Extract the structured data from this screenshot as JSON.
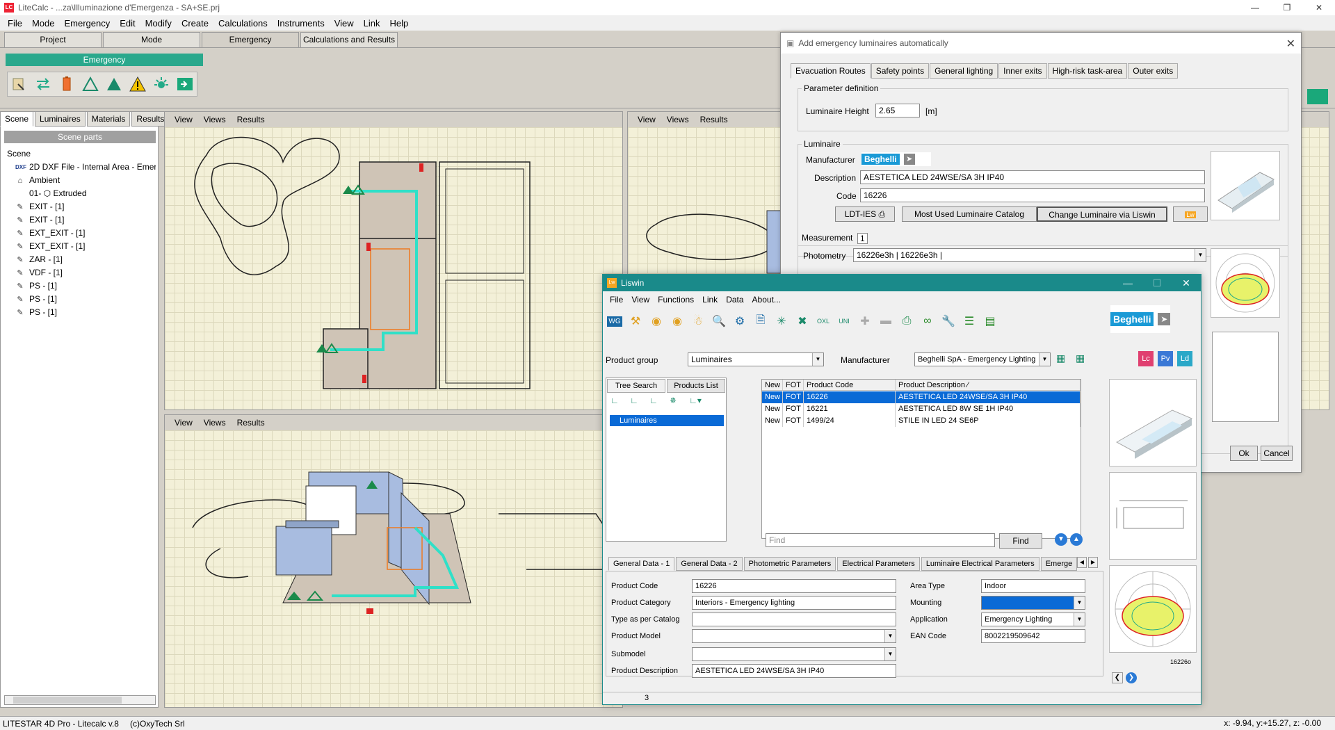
{
  "app": {
    "title": "LiteCalc - ...za\\Illuminazione d'Emergenza - SA+SE.prj",
    "icon_text": "LC",
    "window_controls": [
      "—",
      "❐",
      "✕"
    ]
  },
  "menubar": [
    "File",
    "Mode",
    "Emergency",
    "Edit",
    "Modify",
    "Create",
    "Calculations",
    "Instruments",
    "View",
    "Link",
    "Help"
  ],
  "ribbon_tabs": [
    {
      "label": "Project",
      "active": false
    },
    {
      "label": "Mode",
      "active": false
    },
    {
      "label": "Emergency",
      "active": true
    },
    {
      "label": "Calculations and Results",
      "active": false
    }
  ],
  "ribbon": {
    "group_label": "Emergency",
    "icons": [
      "place-luminaire-icon",
      "swap-icon",
      "battery-icon",
      "triangle-outline-icon",
      "triangle-filled-icon",
      "warning-icon",
      "lamp-icon",
      "exit-sign-icon"
    ]
  },
  "left_panel": {
    "tabs": [
      "Scene",
      "Luminaires",
      "Materials",
      "Results"
    ],
    "active_tab": "Scene",
    "header": "Scene parts",
    "tree": [
      {
        "label": "Scene",
        "icon": ""
      },
      {
        "label": "2D DXF File - Internal Area - Emer",
        "icon": "DXF"
      },
      {
        "label": "Ambient",
        "icon": "⌂"
      },
      {
        "label": "01- ⬡ Extruded",
        "icon": ""
      },
      {
        "label": "EXIT - [1]",
        "icon": "✎"
      },
      {
        "label": "EXIT - [1]",
        "icon": "✎"
      },
      {
        "label": "EXT_EXIT - [1]",
        "icon": "✎"
      },
      {
        "label": "EXT_EXIT - [1]",
        "icon": "✎"
      },
      {
        "label": "ZAR - [1]",
        "icon": "✎"
      },
      {
        "label": "VDF - [1]",
        "icon": "✎"
      },
      {
        "label": "PS - [1]",
        "icon": "✎"
      },
      {
        "label": "PS - [1]",
        "icon": "✎"
      },
      {
        "label": "PS - [1]",
        "icon": "✎"
      }
    ]
  },
  "viewports": {
    "menu": [
      "View",
      "Views",
      "Results"
    ]
  },
  "dialog": {
    "title": "Add emergency luminaires automatically",
    "tabs": [
      {
        "label": "Evacuation Routes",
        "active": true
      },
      {
        "label": "Safety points",
        "active": false
      },
      {
        "label": "General lighting",
        "active": false
      },
      {
        "label": "Inner exits",
        "active": false
      },
      {
        "label": "High-risk task-area",
        "active": false
      },
      {
        "label": "Outer exits",
        "active": false
      }
    ],
    "param_group": "Parameter definition",
    "height_label": "Luminaire Height",
    "height_value": "2.65",
    "height_unit": "[m]",
    "luminaire_group": "Luminaire",
    "manufacturer_label": "Manufacturer",
    "manufacturer_logo": "Beghelli",
    "description_label": "Description",
    "description_value": "AESTETICA LED 24WSE/SA 3H IP40",
    "code_label": "Code",
    "code_value": "16226",
    "buttons": {
      "ldt": "LDT-IES",
      "most_used": "Most Used Luminaire Catalog",
      "change": "Change Luminaire via Liswin",
      "lw": "Lw"
    },
    "measurement_label": "Measurement",
    "measurement_value": "1",
    "photometry_label": "Photometry",
    "photometry_value": "16226e3h | 16226e3h |",
    "ok": "Ok",
    "cancel": "Cancel"
  },
  "liswin": {
    "title": "Liswin",
    "icon_text": "Lw",
    "window_controls": [
      "—",
      "☐",
      "✕"
    ],
    "menu": [
      "File",
      "View",
      "Functions",
      "Link",
      "Data",
      "About..."
    ],
    "brand_logo": "Beghelli",
    "product_group_label": "Product group",
    "product_group_value": "Luminaires",
    "manufacturer_label": "Manufacturer",
    "manufacturer_value": "Beghelli SpA - Emergency Lighting",
    "badges": [
      "Lc",
      "Pv",
      "Ld"
    ],
    "search_tabs": [
      {
        "label": "Tree Search",
        "active": true
      },
      {
        "label": "Products List",
        "active": false
      }
    ],
    "tree_item": "Luminaires",
    "table": {
      "headers": [
        "New",
        "FOT",
        "Product Code",
        "Product Description ∕"
      ],
      "rows": [
        {
          "cells": [
            "New",
            "FOT",
            "16226",
            "AESTETICA LED 24WSE/SA 3H IP40"
          ],
          "selected": true
        },
        {
          "cells": [
            "New",
            "FOT",
            "16221",
            "AESTETICA LED 8W SE 1H IP40"
          ],
          "selected": false
        },
        {
          "cells": [
            "New",
            "FOT",
            "1499/24",
            "STILE IN LED 24 SE6P"
          ],
          "selected": false
        }
      ]
    },
    "find_placeholder": "Find",
    "find_button": "Find",
    "detail_tabs": [
      {
        "label": "General Data - 1",
        "active": true
      },
      {
        "label": "General Data - 2",
        "active": false
      },
      {
        "label": "Photometric Parameters",
        "active": false
      },
      {
        "label": "Electrical Parameters",
        "active": false
      },
      {
        "label": "Luminaire Electrical Parameters",
        "active": false
      },
      {
        "label": "Emerge",
        "active": false
      }
    ],
    "details_left": [
      {
        "label": "Product Code",
        "value": "16226",
        "combo": false
      },
      {
        "label": "Product Category",
        "value": "Interiors - Emergency lighting",
        "combo": false
      },
      {
        "label": "Type as per Catalog",
        "value": "",
        "combo": false
      },
      {
        "label": "Product Model",
        "value": "",
        "combo": true
      },
      {
        "label": "Submodel",
        "value": "",
        "combo": true
      },
      {
        "label": "Product Description",
        "value": "AESTETICA LED 24WSE/SA 3H IP40",
        "combo": false
      }
    ],
    "details_right": [
      {
        "label": "Area Type",
        "value": "Indoor",
        "combo": false
      },
      {
        "label": "Mounting",
        "value": "",
        "combo": true
      },
      {
        "label": "Application",
        "value": "Emergency Lighting",
        "combo": true
      },
      {
        "label": "EAN Code",
        "value": "8002219509642",
        "combo": false
      }
    ],
    "thumb_caption": "16226o",
    "status_page": "3"
  },
  "statusbar": {
    "left": "LITESTAR 4D Pro - Litecalc v.8",
    "copyright": "(c)OxyTech Srl",
    "coords": "x: -9.94, y:+15.27, z: -0.00"
  },
  "colors": {
    "accent": "#2aa88c",
    "liswin_title": "#1a8a8a",
    "selection": "#0a6ad6",
    "route": "#2fe0c8"
  }
}
